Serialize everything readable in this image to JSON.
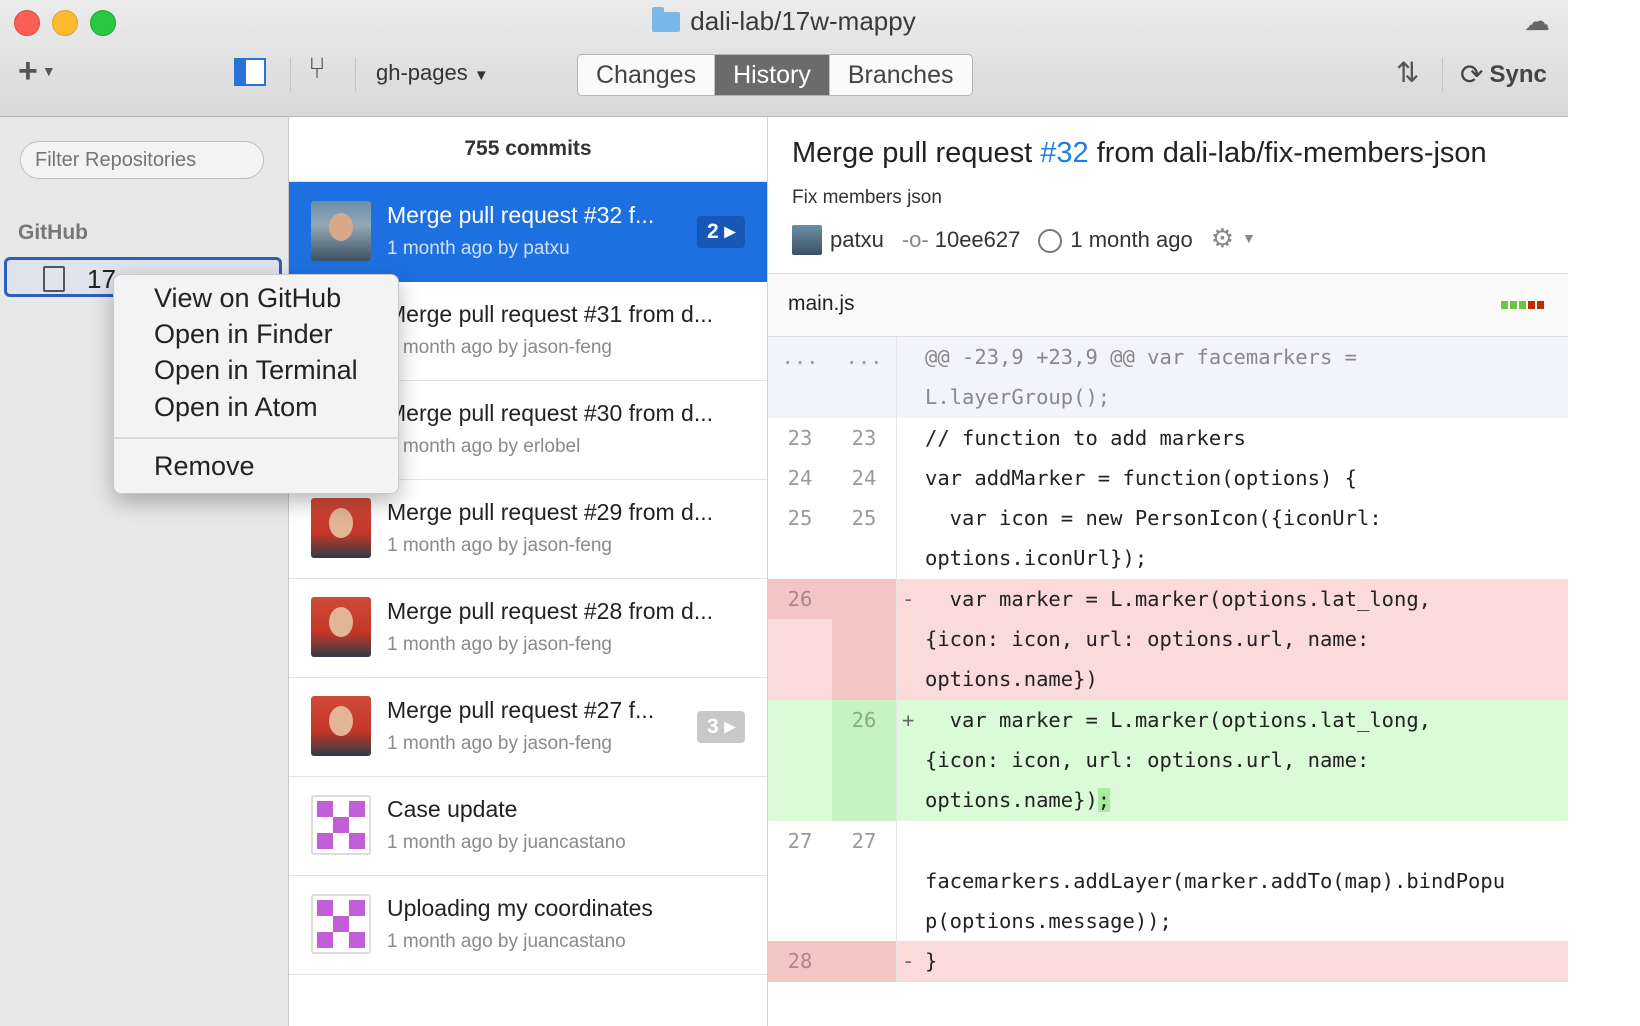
{
  "window": {
    "title": "dali-lab/17w-mappy",
    "branch": "gh-pages",
    "tabs": [
      "Changes",
      "History",
      "Branches"
    ],
    "active_tab": "History",
    "sync_label": "Sync"
  },
  "sidebar": {
    "filter_placeholder": "Filter Repositories",
    "section": "GitHub",
    "repo_label": "17"
  },
  "context_menu": {
    "items": [
      "View on GitHub",
      "Open in Finder",
      "Open in Terminal",
      "Open in Atom"
    ],
    "remove_label": "Remove"
  },
  "commits": {
    "count_label": "755 commits",
    "items": [
      {
        "title": "Merge pull request #32 f...",
        "meta": "1 month ago by patxu",
        "badge": "2 ▸",
        "selected": true
      },
      {
        "title": "Merge pull request #31 from d...",
        "meta": "1 month ago by jason-feng"
      },
      {
        "title": "Merge pull request #30 from d...",
        "meta": "1 month ago by erlobel"
      },
      {
        "title": "Merge pull request #29 from d...",
        "meta": "1 month ago by jason-feng"
      },
      {
        "title": "Merge pull request #28 from d...",
        "meta": "1 month ago by jason-feng"
      },
      {
        "title": "Merge pull request #27 f...",
        "meta": "1 month ago by jason-feng",
        "badge": "3 ▸"
      },
      {
        "title": "Case update",
        "meta": "1 month ago by juancastano"
      },
      {
        "title": "Uploading my coordinates",
        "meta": "1 month ago by juancastano"
      }
    ]
  },
  "detail": {
    "title_prefix": "Merge pull request ",
    "title_num": "#32",
    "title_suffix": " from dali-lab/fix-members-json",
    "subtitle": "Fix members json",
    "author": "patxu",
    "sha": "10ee627",
    "time": "1 month ago",
    "file": "main.js",
    "diff_stat_colors": [
      "#6cc644",
      "#6cc644",
      "#6cc644",
      "#bd2c00",
      "#bd2c00"
    ],
    "diff": [
      {
        "type": "hunk",
        "n1": "...",
        "n2": "...",
        "sign": "",
        "code": "@@ -23,9 +23,9 @@ var facemarkers ="
      },
      {
        "type": "hunk",
        "n1": "",
        "n2": "",
        "sign": "",
        "code": "L.layerGroup();"
      },
      {
        "type": "ctx",
        "n1": "23",
        "n2": "23",
        "sign": "",
        "code": "// function to add markers"
      },
      {
        "type": "ctx",
        "n1": "24",
        "n2": "24",
        "sign": "",
        "code": "var addMarker = function(options) {"
      },
      {
        "type": "ctx",
        "n1": "25",
        "n2": "25",
        "sign": "",
        "code": "  var icon = new PersonIcon({iconUrl:"
      },
      {
        "type": "ctx",
        "n1": "",
        "n2": "",
        "sign": "",
        "code": "options.iconUrl});"
      },
      {
        "type": "del",
        "n1": "26",
        "n2": "",
        "sign": "-",
        "code": "  var marker = L.marker(options.lat_long,"
      },
      {
        "type": "del",
        "n1": "",
        "n2": "",
        "sign": "",
        "code": "{icon: icon, url: options.url, name:"
      },
      {
        "type": "del",
        "n1": "",
        "n2": "",
        "sign": "",
        "code": "options.name})"
      },
      {
        "type": "add",
        "n1": "",
        "n2": "26",
        "sign": "+",
        "code": "  var marker = L.marker(options.lat_long,"
      },
      {
        "type": "add",
        "n1": "",
        "n2": "",
        "sign": "",
        "code": "{icon: icon, url: options.url, name:"
      },
      {
        "type": "add",
        "n1": "",
        "n2": "",
        "sign": "",
        "code": "options.name})",
        "hl": ";"
      },
      {
        "type": "ctx",
        "n1": "27",
        "n2": "27",
        "sign": "",
        "code": ""
      },
      {
        "type": "ctx",
        "n1": "",
        "n2": "",
        "sign": "",
        "code": "facemarkers.addLayer(marker.addTo(map).bindPopu"
      },
      {
        "type": "ctx",
        "n1": "",
        "n2": "",
        "sign": "",
        "code": "p(options.message));"
      },
      {
        "type": "del",
        "n1": "28",
        "n2": "",
        "sign": "-",
        "code": "}"
      }
    ]
  }
}
